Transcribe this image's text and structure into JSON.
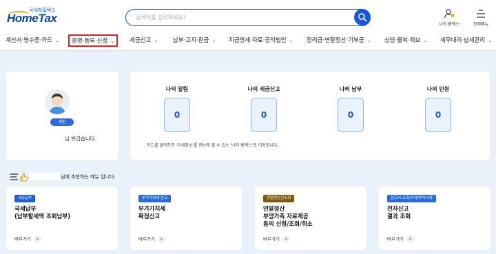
{
  "header": {
    "logo_small": "국세청홈택스",
    "logo_big": "HomeTax",
    "search_placeholder": "검색어를 입력하세요!",
    "my_hometax_label": "나의 홈택스",
    "all_menu_label": "전체메뉴"
  },
  "nav": {
    "items": [
      {
        "label": "계산서·영수증·카드"
      },
      {
        "label": "증명·등록·신청"
      },
      {
        "label": "세금신고"
      },
      {
        "label": "납부·고지·환급"
      },
      {
        "label": "지급명세·자료·공익법인"
      },
      {
        "label": "장려금·연말정산·기부금"
      },
      {
        "label": "상담·불복·제보"
      },
      {
        "label": "세무대리·납세관리"
      }
    ],
    "active_index": 1
  },
  "profile": {
    "badge": "개인",
    "greeting": "님 반갑습니다."
  },
  "status": {
    "items": [
      {
        "title": "나의 알림",
        "count": "0"
      },
      {
        "title": "나의 세금신고",
        "count": "0"
      },
      {
        "title": "나의 납부",
        "count": "0"
      },
      {
        "title": "나의 민원",
        "count": "0"
      }
    ],
    "note": "카드를 클릭하면 '국세정보'를 한눈에 볼 수 있는 '나의 홈택스'로 이동합니다."
  },
  "recommend": {
    "title_suffix": "님께 추천하는 메뉴 입니다."
  },
  "services": [
    {
      "tag": "세금납부",
      "tag_color": "#1f5fd1",
      "title": [
        "국세납부",
        "(납부할세액 조회납부)"
      ],
      "link": "바로가기"
    },
    {
      "tag": "부가가치세 신고",
      "tag_color": "#2a6bd6",
      "title": [
        "부가가치세",
        "확정신고"
      ],
      "link": "바로가기"
    },
    {
      "tag": "연말정산간소화",
      "tag_color": "#7a5a10",
      "title": [
        "연말정산",
        "부양가족 자료제공",
        "동의 신청/조회/취소"
      ],
      "link": "바로가기"
    },
    {
      "tag": "신고서 조회/삭제/부속서류",
      "tag_color": "#2a6bd6",
      "title": [
        "전자신고",
        "결과 조회"
      ],
      "link": "바로가기"
    }
  ],
  "colors": {
    "accent": "#1a56db",
    "background": "#e9f1fa",
    "active_outline": "#e02020"
  }
}
